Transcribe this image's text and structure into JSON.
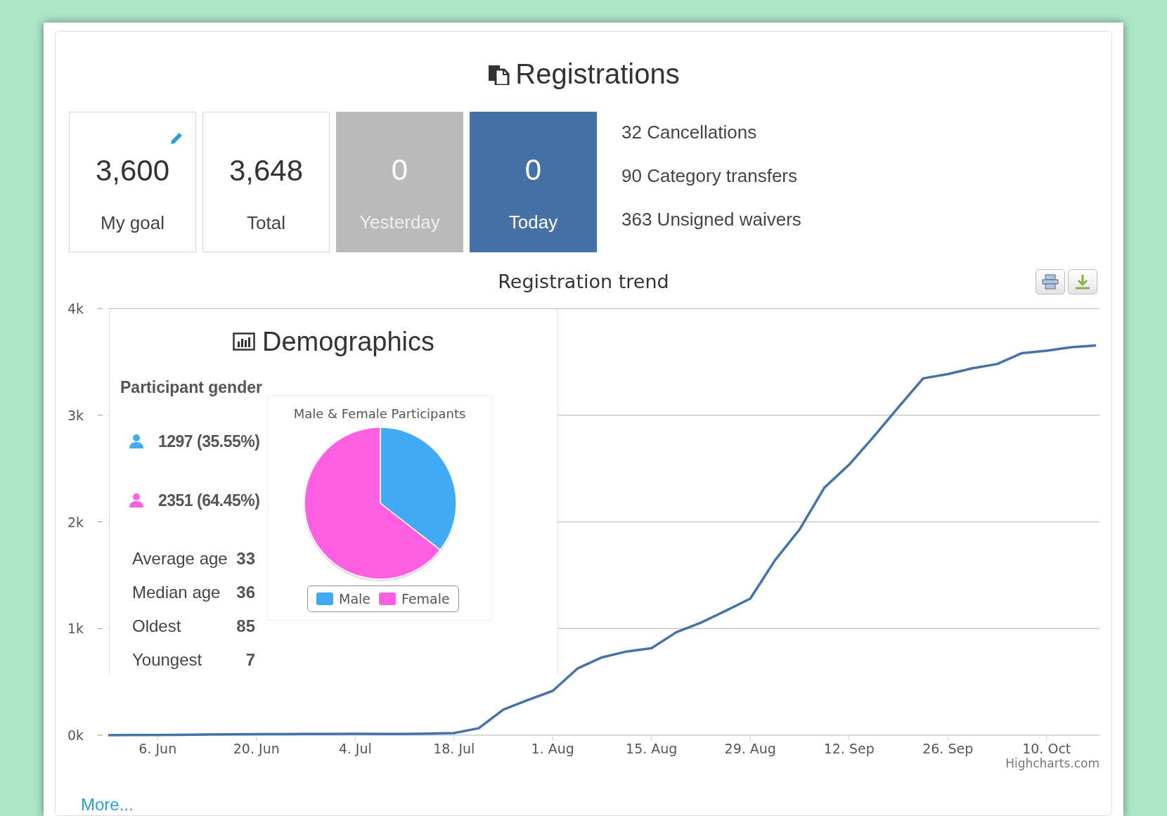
{
  "title": "Registrations",
  "stats": [
    {
      "value": "3,600",
      "label": "My goal",
      "kind": "outline",
      "editable": true
    },
    {
      "value": "3,648",
      "label": "Total",
      "kind": "outline",
      "editable": false
    },
    {
      "value": "0",
      "label": "Yesterday",
      "kind": "grey",
      "editable": false
    },
    {
      "value": "0",
      "label": "Today",
      "kind": "blue",
      "editable": false
    }
  ],
  "side_stats": [
    "32 Cancellations",
    "90 Category transfers",
    "363 Unsigned waivers"
  ],
  "trend": {
    "title": "Registration trend",
    "credit": "Highcharts.com",
    "chart_data": {
      "type": "line",
      "grid": true,
      "ylim": [
        0,
        4000
      ],
      "categories": [
        null,
        null,
        "6. Jun",
        null,
        null,
        null,
        "20. Jun",
        null,
        null,
        null,
        "4. Jul",
        null,
        null,
        null,
        "18. Jul",
        null,
        null,
        null,
        "1. Aug",
        null,
        null,
        null,
        "15. Aug",
        null,
        null,
        null,
        "29. Aug",
        null,
        null,
        null,
        "12. Sep",
        null,
        null,
        null,
        "26. Sep",
        null,
        null,
        null,
        "10. Oct",
        null,
        null
      ],
      "yticks": [
        {
          "value": 0,
          "label": "0k"
        },
        {
          "value": 1000,
          "label": "1k"
        },
        {
          "value": 2000,
          "label": "2k"
        },
        {
          "value": 3000,
          "label": "3k"
        },
        {
          "value": 4000,
          "label": "4k"
        }
      ],
      "series": [
        {
          "color": "#4572a7",
          "values": [
            0,
            1,
            2,
            4,
            6,
            8,
            9,
            10,
            11,
            12,
            14,
            12,
            12,
            15,
            20,
            65,
            240,
            330,
            415,
            625,
            730,
            785,
            815,
            965,
            1055,
            1165,
            1280,
            1640,
            1930,
            2320,
            2535,
            2800,
            3075,
            3345,
            3385,
            3440,
            3480,
            3582,
            3605,
            3638,
            3655
          ]
        }
      ]
    }
  },
  "demographics": {
    "title": "Demographics",
    "gender_heading": "Participant gender",
    "genders": [
      {
        "text": "1297 (35.55%)",
        "color": "#42a9f5"
      },
      {
        "text": "2351 (64.45%)",
        "color": "#ff5fe0"
      }
    ],
    "ages": [
      {
        "label": "Average age",
        "value": "33"
      },
      {
        "label": "Median age",
        "value": "36"
      },
      {
        "label": "Oldest",
        "value": "85"
      },
      {
        "label": "Youngest",
        "value": "7"
      }
    ],
    "pie": {
      "chart_data": {
        "type": "pie",
        "title": "Male & Female Participants",
        "categories": [
          "Male",
          "Female"
        ],
        "series": [
          {
            "values": [
              35.55,
              64.45
            ]
          }
        ],
        "legend": "bottom",
        "colors": [
          "#42a9f5",
          "#ff5fe0"
        ]
      }
    }
  },
  "more_link": "More..."
}
